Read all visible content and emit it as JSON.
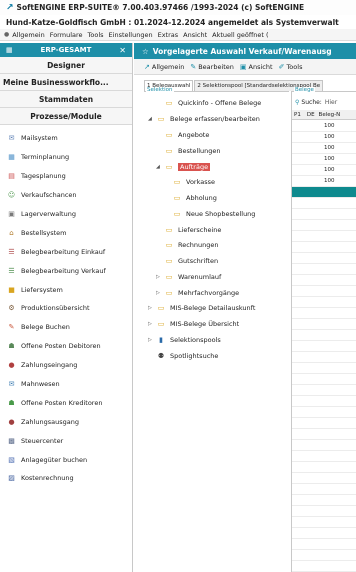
{
  "window": {
    "title": "SoftENGINE ERP-SUITE® 7.00.403.97466 /1993-2024 (c) SoftENGINE",
    "info": "Hund-Katze-Goldfisch GmbH : 01.2024-12.2024 angemeldet als Systemverwalt"
  },
  "menu": [
    "Allgemein",
    "Formulare",
    "Tools",
    "Einstellungen",
    "Extras",
    "Ansicht",
    "Aktuell geöffnet ("
  ],
  "left": {
    "header": "ERP-GESAMT",
    "nav": [
      "Designer",
      "Meine Businessworkflo...",
      "Stammdaten",
      "Prozesse/Module"
    ],
    "items": [
      {
        "label": "Mailsystem",
        "icon": "mail-icon",
        "color": "#5b7fb5"
      },
      {
        "label": "Terminplanung",
        "icon": "calendar-icon",
        "color": "#4a8fc7"
      },
      {
        "label": "Tagesplanung",
        "icon": "calendar-day-icon",
        "color": "#c94a4a"
      },
      {
        "label": "Verkaufschancen",
        "icon": "handshake-icon",
        "color": "#5a9e5a"
      },
      {
        "label": "Lagerverwaltung",
        "icon": "warehouse-icon",
        "color": "#7a7a7a"
      },
      {
        "label": "Bestellsystem",
        "icon": "cart-icon",
        "color": "#b07a2a"
      },
      {
        "label": "Belegbearbeitung Einkauf",
        "icon": "document-icon",
        "color": "#b05050"
      },
      {
        "label": "Belegbearbeitung Verkauf",
        "icon": "document-icon",
        "color": "#4f8f4f"
      },
      {
        "label": "Liefersystem",
        "icon": "truck-icon",
        "color": "#d9a520"
      },
      {
        "label": "Produktionsübersicht",
        "icon": "factory-icon",
        "color": "#7a5a3a"
      },
      {
        "label": "Belege Buchen",
        "icon": "booking-icon",
        "color": "#c9563a"
      },
      {
        "label": "Offene Posten Debitoren",
        "icon": "debtor-icon",
        "color": "#5a8a5a"
      },
      {
        "label": "Zahlungseingang",
        "icon": "payment-in-icon",
        "color": "#b04040"
      },
      {
        "label": "Mahnwesen",
        "icon": "reminder-icon",
        "color": "#3a7ab0"
      },
      {
        "label": "Offene Posten Kreditoren",
        "icon": "creditor-icon",
        "color": "#4a9a4a"
      },
      {
        "label": "Zahlungsausgang",
        "icon": "payment-out-icon",
        "color": "#a04040"
      },
      {
        "label": "Steuercenter",
        "icon": "tax-icon",
        "color": "#5a6a8a"
      },
      {
        "label": "Anlagegüter buchen",
        "icon": "asset-icon",
        "color": "#4a6ab0"
      },
      {
        "label": "Kostenrechnung",
        "icon": "cost-icon",
        "color": "#3a5a9a"
      }
    ]
  },
  "right": {
    "header": "Vorgelagerte Auswahl Verkauf/Warenausg",
    "toolbar": [
      "Allgemein",
      "Bearbeiten",
      "Ansicht",
      "Tools"
    ],
    "tabs": [
      "1 Belegauswahl",
      "2 Selektionspool [Standardselektionspool Be"
    ],
    "section_left": "Selektion",
    "section_right": "Belege",
    "tree": [
      {
        "label": "Quickinfo - Offene Belege",
        "arrow": "",
        "level": 1
      },
      {
        "label": "Belege erfassen/bearbeiten",
        "arrow": "◢",
        "level": 0
      },
      {
        "label": "Angebote",
        "arrow": "",
        "level": 1
      },
      {
        "label": "Bestellungen",
        "arrow": "",
        "level": 1
      },
      {
        "label": "Aufträge",
        "arrow": "◢",
        "level": 1,
        "selected": true
      },
      {
        "label": "Vorkasse",
        "arrow": "",
        "level": 2
      },
      {
        "label": "Abholung",
        "arrow": "",
        "level": 2
      },
      {
        "label": "Neue Shopbestellung",
        "arrow": "",
        "level": 2
      },
      {
        "label": "Lieferscheine",
        "arrow": "",
        "level": 1
      },
      {
        "label": "Rechnungen",
        "arrow": "",
        "level": 1
      },
      {
        "label": "Gutschriften",
        "arrow": "",
        "level": 1
      },
      {
        "label": "Warenumlauf",
        "arrow": "▷",
        "level": 1
      },
      {
        "label": "Mehrfachvorgänge",
        "arrow": "▷",
        "level": 1
      },
      {
        "label": "MIS-Belege Detailauskunft",
        "arrow": "▷",
        "level": 0
      },
      {
        "label": "MIS-Belege Übersicht",
        "arrow": "▷",
        "level": 0
      },
      {
        "label": "Selektionspools",
        "arrow": "▷",
        "level": 0
      },
      {
        "label": "Spotlightsuche",
        "arrow": "",
        "level": 0
      }
    ],
    "search_label": "Suche:",
    "search_value": "Hier",
    "columns": [
      "P1",
      "DE",
      "Beleg-N"
    ],
    "rows": [
      "100",
      "100",
      "100",
      "100",
      "100",
      "100"
    ]
  }
}
